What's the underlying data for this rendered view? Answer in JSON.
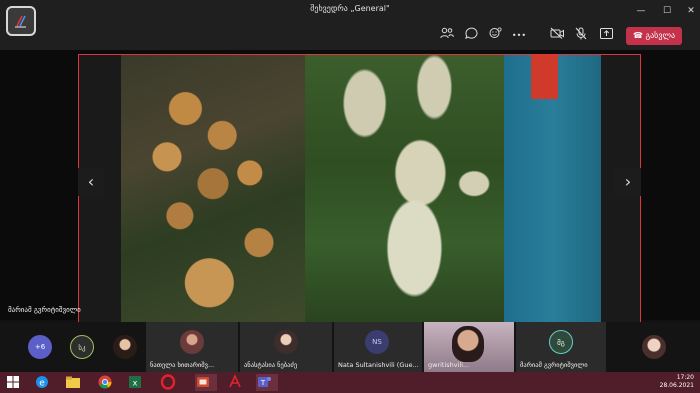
{
  "window": {
    "title": "შეხვედრა „General\"",
    "minimize_glyph": "—",
    "maximize_glyph": "☐",
    "close_glyph": "✕"
  },
  "toolbar": {
    "icons": [
      "participants-icon",
      "chat-icon",
      "reactions-icon",
      "more-icon",
      "camera-off-icon",
      "mic-off-icon",
      "share-icon"
    ],
    "more_glyph": "•••",
    "leave_label": "გასვლა",
    "leave_color": "#c4314b"
  },
  "stage": {
    "presenter_name": "მარიამ გვრიტიშვილი",
    "prev_glyph": "‹",
    "next_glyph": "›",
    "frame_color": "#e0343c"
  },
  "participants": {
    "overflow_count": "+6",
    "items": [
      {
        "initials": "სკ"
      },
      {
        "name": "ნათელა ხითარიშვ..."
      },
      {
        "name": "ანასტასია ნებაძე"
      },
      {
        "initials": "NS",
        "name": "Nata Sultanishvili (Gue..."
      },
      {
        "name": "gwritishvili..."
      },
      {
        "initials": "მგ",
        "name": "მარიამ გვრიტიშვილი"
      }
    ]
  },
  "taskbar": {
    "apps": [
      "start-icon",
      "ie-icon",
      "explorer-icon",
      "chrome-icon",
      "excel-icon",
      "opera-icon",
      "powerpoint-icon",
      "pdf-icon",
      "teams-icon"
    ],
    "time": "17:20",
    "date": "28.06.2021",
    "background": "#4f1e2a"
  }
}
